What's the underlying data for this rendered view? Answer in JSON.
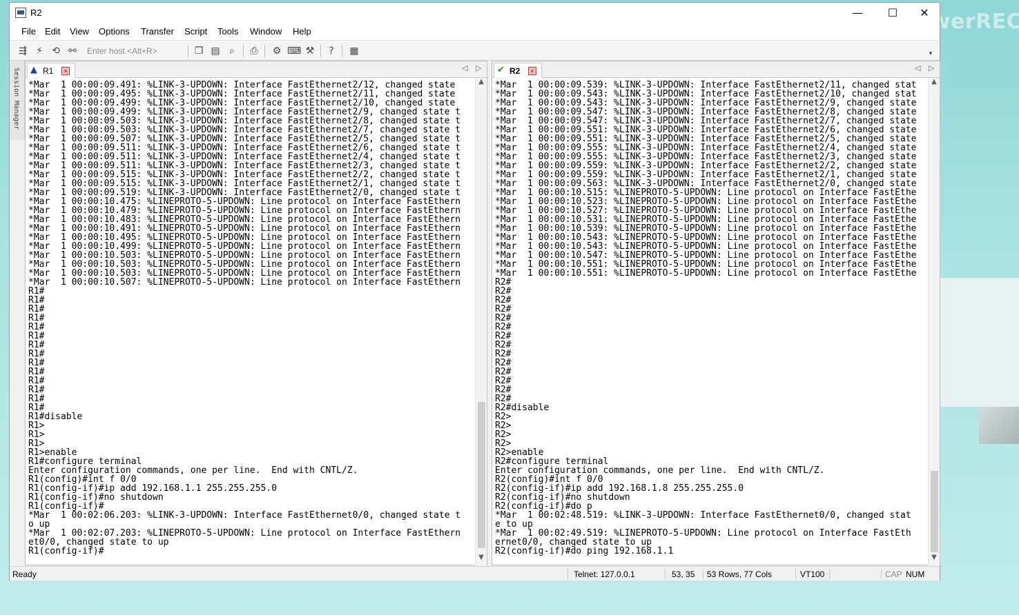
{
  "window": {
    "title": "R2",
    "minimize_glyph": "—",
    "maximize_glyph": "☐",
    "close_glyph": "✕"
  },
  "watermark": "ApowerREC",
  "menu": [
    "File",
    "Edit",
    "View",
    "Options",
    "Transfer",
    "Script",
    "Tools",
    "Window",
    "Help"
  ],
  "toolbar": {
    "host_placeholder": "Enter host <Alt+R>",
    "icons": [
      "connect-icon",
      "lightning-icon",
      "reconnect-icon",
      "disconnect-icon",
      "copy-icon",
      "paste-icon",
      "find-icon",
      "print-icon",
      "settings-icon",
      "keymap-icon",
      "sftp-icon",
      "help-icon",
      "map-icon"
    ]
  },
  "session_manager_label": "Session Manager",
  "left_pane": {
    "tab_label": "R1",
    "tab_status_icon": "warning-icon",
    "lines": [
      "*Mar  1 00:00:09.491: %LINK-3-UPDOWN: Interface FastEthernet2/12, changed state",
      "*Mar  1 00:00:09.495: %LINK-3-UPDOWN: Interface FastEthernet2/11, changed state",
      "*Mar  1 00:00:09.499: %LINK-3-UPDOWN: Interface FastEthernet2/10, changed state",
      "*Mar  1 00:00:09.499: %LINK-3-UPDOWN: Interface FastEthernet2/9, changed state t",
      "*Mar  1 00:00:09.503: %LINK-3-UPDOWN: Interface FastEthernet2/8, changed state t",
      "*Mar  1 00:00:09.503: %LINK-3-UPDOWN: Interface FastEthernet2/7, changed state t",
      "*Mar  1 00:00:09.507: %LINK-3-UPDOWN: Interface FastEthernet2/5, changed state t",
      "*Mar  1 00:00:09.511: %LINK-3-UPDOWN: Interface FastEthernet2/6, changed state t",
      "*Mar  1 00:00:09.511: %LINK-3-UPDOWN: Interface FastEthernet2/4, changed state t",
      "*Mar  1 00:00:09.511: %LINK-3-UPDOWN: Interface FastEthernet2/3, changed state t",
      "*Mar  1 00:00:09.515: %LINK-3-UPDOWN: Interface FastEthernet2/2, changed state t",
      "*Mar  1 00:00:09.515: %LINK-3-UPDOWN: Interface FastEthernet2/1, changed state t",
      "*Mar  1 00:00:09.519: %LINK-3-UPDOWN: Interface FastEthernet2/0, changed state t",
      "*Mar  1 00:00:10.475: %LINEPROTO-5-UPDOWN: Line protocol on Interface FastEthern",
      "*Mar  1 00:00:10.479: %LINEPROTO-5-UPDOWN: Line protocol on Interface FastEthern",
      "*Mar  1 00:00:10.483: %LINEPROTO-5-UPDOWN: Line protocol on Interface FastEthern",
      "*Mar  1 00:00:10.491: %LINEPROTO-5-UPDOWN: Line protocol on Interface FastEthern",
      "*Mar  1 00:00:10.495: %LINEPROTO-5-UPDOWN: Line protocol on Interface FastEthern",
      "*Mar  1 00:00:10.499: %LINEPROTO-5-UPDOWN: Line protocol on Interface FastEthern",
      "*Mar  1 00:00:10.503: %LINEPROTO-5-UPDOWN: Line protocol on Interface FastEthern",
      "*Mar  1 00:00:10.503: %LINEPROTO-5-UPDOWN: Line protocol on Interface FastEthern",
      "*Mar  1 00:00:10.503: %LINEPROTO-5-UPDOWN: Line protocol on Interface FastEthern",
      "*Mar  1 00:00:10.507: %LINEPROTO-5-UPDOWN: Line protocol on Interface FastEthern",
      "R1#",
      "R1#",
      "R1#",
      "R1#",
      "R1#",
      "R1#",
      "R1#",
      "R1#",
      "R1#",
      "R1#",
      "R1#",
      "R1#",
      "R1#",
      "R1#",
      "R1#disable",
      "R1>",
      "R1>",
      "R1>",
      "R1>enable",
      "R1#configure terminal",
      "Enter configuration commands, one per line.  End with CNTL/Z.",
      "R1(config)#int f 0/0",
      "R1(config-if)#ip add 192.168.1.1 255.255.255.0",
      "R1(config-if)#no shutdown",
      "R1(config-if)#",
      "*Mar  1 00:02:06.203: %LINK-3-UPDOWN: Interface FastEthernet0/0, changed state t",
      "o up",
      "*Mar  1 00:02:07.203: %LINEPROTO-5-UPDOWN: Line protocol on Interface FastEthern",
      "et0/0, changed state to up",
      "R1(config-if)#"
    ]
  },
  "right_pane": {
    "tab_label": "R2",
    "tab_status_icon": "checkmark-icon",
    "lines": [
      "*Mar  1 00:00:09.539: %LINK-3-UPDOWN: Interface FastEthernet2/11, changed stat",
      "*Mar  1 00:00:09.543: %LINK-3-UPDOWN: Interface FastEthernet2/10, changed stat",
      "*Mar  1 00:00:09.543: %LINK-3-UPDOWN: Interface FastEthernet2/9, changed state",
      "*Mar  1 00:00:09.547: %LINK-3-UPDOWN: Interface FastEthernet2/8, changed state",
      "*Mar  1 00:00:09.547: %LINK-3-UPDOWN: Interface FastEthernet2/7, changed state",
      "*Mar  1 00:00:09.551: %LINK-3-UPDOWN: Interface FastEthernet2/6, changed state",
      "*Mar  1 00:00:09.551: %LINK-3-UPDOWN: Interface FastEthernet2/5, changed state",
      "*Mar  1 00:00:09.555: %LINK-3-UPDOWN: Interface FastEthernet2/4, changed state",
      "*Mar  1 00:00:09.555: %LINK-3-UPDOWN: Interface FastEthernet2/3, changed state",
      "*Mar  1 00:00:09.559: %LINK-3-UPDOWN: Interface FastEthernet2/2, changed state",
      "*Mar  1 00:00:09.559: %LINK-3-UPDOWN: Interface FastEthernet2/1, changed state",
      "*Mar  1 00:00:09.563: %LINK-3-UPDOWN: Interface FastEthernet2/0, changed state",
      "*Mar  1 00:00:10.515: %LINEPROTO-5-UPDOWN: Line protocol on Interface FastEthe",
      "*Mar  1 00:00:10.523: %LINEPROTO-5-UPDOWN: Line protocol on Interface FastEthe",
      "*Mar  1 00:00:10.527: %LINEPROTO-5-UPDOWN: Line protocol on Interface FastEthe",
      "*Mar  1 00:00:10.531: %LINEPROTO-5-UPDOWN: Line protocol on Interface FastEthe",
      "*Mar  1 00:00:10.539: %LINEPROTO-5-UPDOWN: Line protocol on Interface FastEthe",
      "*Mar  1 00:00:10.543: %LINEPROTO-5-UPDOWN: Line protocol on Interface FastEthe",
      "*Mar  1 00:00:10.543: %LINEPROTO-5-UPDOWN: Line protocol on Interface FastEthe",
      "*Mar  1 00:00:10.547: %LINEPROTO-5-UPDOWN: Line protocol on Interface FastEthe",
      "*Mar  1 00:00:10.551: %LINEPROTO-5-UPDOWN: Line protocol on Interface FastEthe",
      "*Mar  1 00:00:10.551: %LINEPROTO-5-UPDOWN: Line protocol on Interface FastEthe",
      "R2#",
      "R2#",
      "R2#",
      "R2#",
      "R2#",
      "R2#",
      "R2#",
      "R2#",
      "R2#",
      "R2#",
      "R2#",
      "R2#",
      "R2#",
      "R2#",
      "R2#disable",
      "R2>",
      "R2>",
      "R2>",
      "R2>",
      "R2>enable",
      "R2#configure terminal",
      "Enter configuration commands, one per line.  End with CNTL/Z.",
      "R2(config)#int f 0/0",
      "R2(config-if)#ip add 192.168.1.8 255.255.255.0",
      "R2(config-if)#no shutdown",
      "R2(config-if)#do p",
      "*Mar  1 00:02:48.519: %LINK-3-UPDOWN: Interface FastEthernet0/0, changed stat",
      "e to up",
      "*Mar  1 00:02:49.519: %LINEPROTO-5-UPDOWN: Line protocol on Interface FastEth",
      "ernet0/0, changed state to up",
      "R2(config-if)#do ping 192.168.1.1"
    ]
  },
  "status": {
    "ready": "Ready",
    "connection": "Telnet: 127.0.0.1",
    "cursor": "53,  35",
    "size": "53 Rows, 77 Cols",
    "emulation": "VT100",
    "caps": "CAP",
    "num": "NUM"
  }
}
